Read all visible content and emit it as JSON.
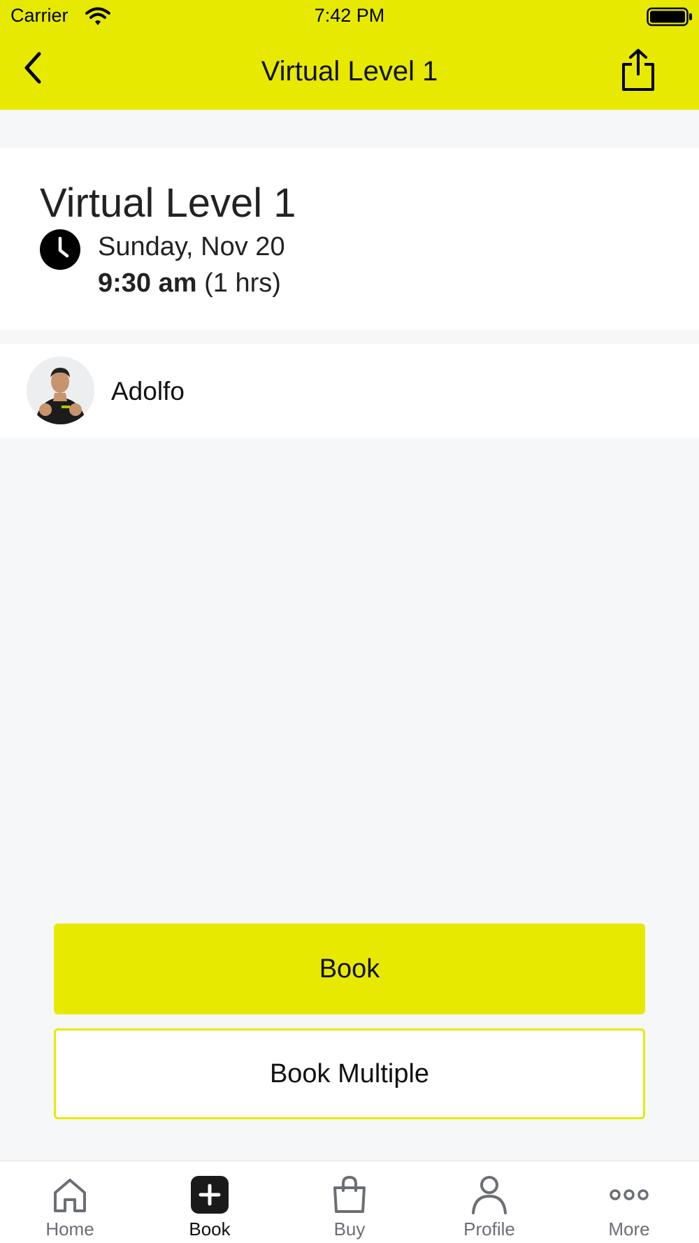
{
  "status_bar": {
    "carrier": "Carrier",
    "time": "7:42 PM"
  },
  "nav": {
    "title": "Virtual Level 1",
    "back_icon": "chevron-left-icon",
    "share_icon": "share-icon"
  },
  "class": {
    "title": "Virtual Level 1",
    "date": "Sunday, Nov 20",
    "time": "9:30 am",
    "duration": "(1 hrs)"
  },
  "instructor": {
    "name": "Adolfo"
  },
  "actions": {
    "book_label": "Book",
    "book_multiple_label": "Book Multiple"
  },
  "tabs": [
    {
      "label": "Home",
      "icon": "home-icon",
      "active": false
    },
    {
      "label": "Book",
      "icon": "plus-square-icon",
      "active": true
    },
    {
      "label": "Buy",
      "icon": "shopping-bag-icon",
      "active": false
    },
    {
      "label": "Profile",
      "icon": "person-icon",
      "active": false
    },
    {
      "label": "More",
      "icon": "more-dots-icon",
      "active": false
    }
  ],
  "colors": {
    "brand": "#e7ea00",
    "background": "#f6f7f9",
    "tab_inactive": "#6b6e74"
  }
}
